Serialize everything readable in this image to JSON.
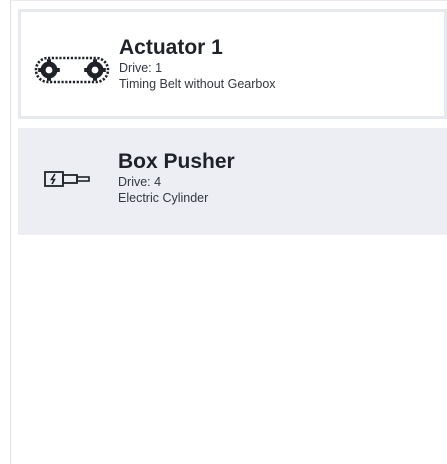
{
  "actuators": [
    {
      "name": "Actuator 1",
      "drive": "Drive: 1",
      "type": "Timing Belt without Gearbox",
      "icon": "timing-belt-icon",
      "selected": true
    },
    {
      "name": "Box Pusher",
      "drive": "Drive: 4",
      "type": "Electric Cylinder",
      "icon": "electric-cylinder-icon",
      "selected": false
    }
  ],
  "colors": {
    "selected_border": "#e6e9ee",
    "item_background": "#eceef3",
    "text": "#1f2329"
  }
}
